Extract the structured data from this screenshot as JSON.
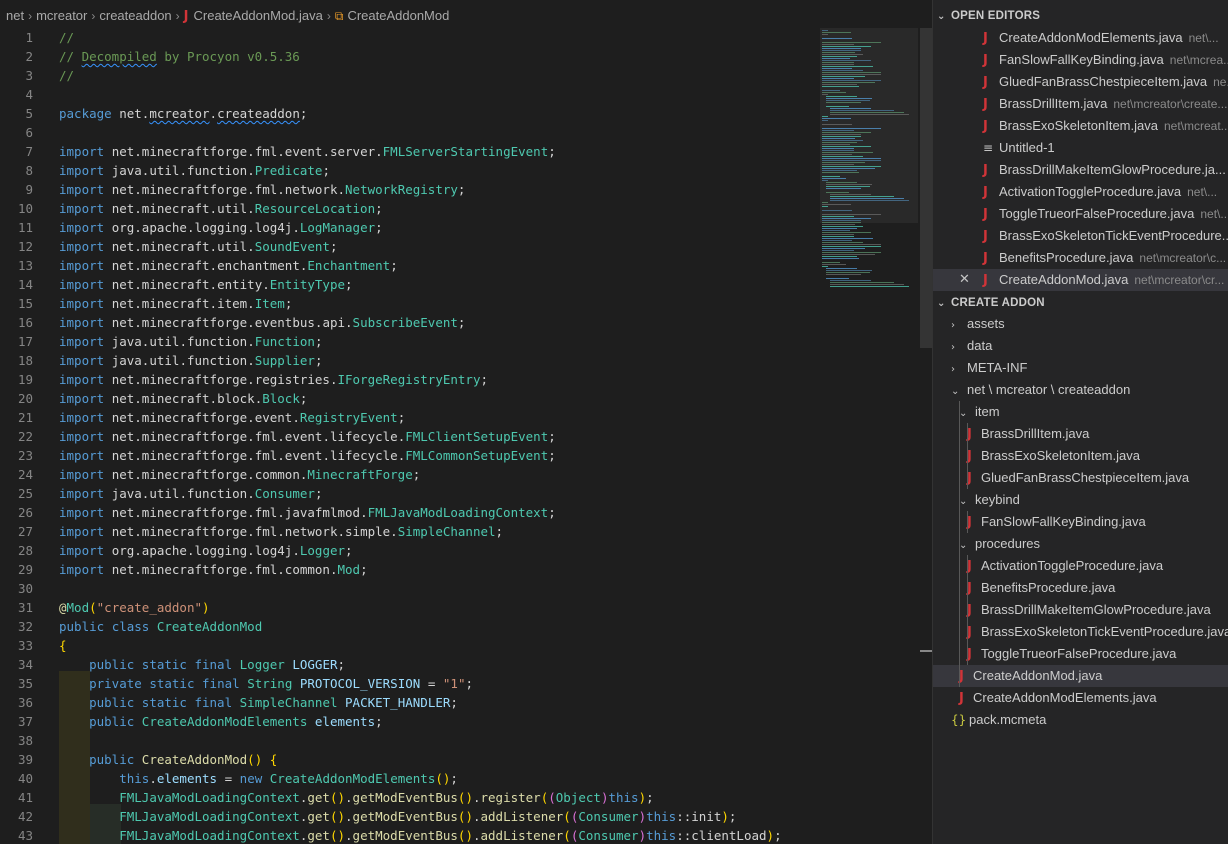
{
  "breadcrumb": {
    "items": [
      "net",
      "mcreator",
      "createaddon",
      "CreateAddonMod.java",
      "CreateAddonMod"
    ],
    "separator": "›"
  },
  "code_lines": [
    "//",
    "// Decompiled by Procyon v0.5.36",
    "//",
    "",
    "package net.mcreator.createaddon;",
    "",
    "import net.minecraftforge.fml.event.server.FMLServerStartingEvent;",
    "import java.util.function.Predicate;",
    "import net.minecraftforge.fml.network.NetworkRegistry;",
    "import net.minecraft.util.ResourceLocation;",
    "import org.apache.logging.log4j.LogManager;",
    "import net.minecraft.util.SoundEvent;",
    "import net.minecraft.enchantment.Enchantment;",
    "import net.minecraft.entity.EntityType;",
    "import net.minecraft.item.Item;",
    "import net.minecraftforge.eventbus.api.SubscribeEvent;",
    "import java.util.function.Function;",
    "import java.util.function.Supplier;",
    "import net.minecraftforge.registries.IForgeRegistryEntry;",
    "import net.minecraft.block.Block;",
    "import net.minecraftforge.event.RegistryEvent;",
    "import net.minecraftforge.fml.event.lifecycle.FMLClientSetupEvent;",
    "import net.minecraftforge.fml.event.lifecycle.FMLCommonSetupEvent;",
    "import net.minecraftforge.common.MinecraftForge;",
    "import java.util.function.Consumer;",
    "import net.minecraftforge.fml.javafmlmod.FMLJavaModLoadingContext;",
    "import net.minecraftforge.fml.network.simple.SimpleChannel;",
    "import org.apache.logging.log4j.Logger;",
    "import net.minecraftforge.fml.common.Mod;",
    "",
    "@Mod(\"create_addon\")",
    "public class CreateAddonMod",
    "{",
    "    public static final Logger LOGGER;",
    "    private static final String PROTOCOL_VERSION = \"1\";",
    "    public static final SimpleChannel PACKET_HANDLER;",
    "    public CreateAddonModElements elements;",
    "",
    "    public CreateAddonMod() {",
    "        this.elements = new CreateAddonModElements();",
    "        FMLJavaModLoadingContext.get().getModEventBus().register((Object)this);",
    "        FMLJavaModLoadingContext.get().getModEventBus().addListener((Consumer)this::init);",
    "        FMLJavaModLoadingContext.get().getModEventBus().addListener((Consumer)this::clientLoad);"
  ],
  "sidebar": {
    "open_editors_title": "OPEN EDITORS",
    "open_editors": [
      {
        "name": "CreateAddonModElements.java",
        "desc": "net\\...",
        "icon": "java"
      },
      {
        "name": "FanSlowFallKeyBinding.java",
        "desc": "net\\mcrea...",
        "icon": "java"
      },
      {
        "name": "GluedFanBrassChestpieceItem.java",
        "desc": "ne...",
        "icon": "java"
      },
      {
        "name": "BrassDrillItem.java",
        "desc": "net\\mcreator\\create...",
        "icon": "java"
      },
      {
        "name": "BrassExoSkeletonItem.java",
        "desc": "net\\mcreat...",
        "icon": "java"
      },
      {
        "name": "Untitled-1",
        "desc": "",
        "icon": "untitled"
      },
      {
        "name": "BrassDrillMakeItemGlowProcedure.ja...",
        "desc": "",
        "icon": "java"
      },
      {
        "name": "ActivationToggleProcedure.java",
        "desc": "net\\...",
        "icon": "java"
      },
      {
        "name": "ToggleTrueorFalseProcedure.java",
        "desc": "net\\...",
        "icon": "java"
      },
      {
        "name": "BrassExoSkeletonTickEventProcedure....",
        "desc": "",
        "icon": "java"
      },
      {
        "name": "BenefitsProcedure.java",
        "desc": "net\\mcreator\\c...",
        "icon": "java"
      },
      {
        "name": "CreateAddonMod.java",
        "desc": "net\\mcreator\\cr...",
        "icon": "java",
        "active": true
      }
    ],
    "project_title": "CREATE ADDON",
    "tree": [
      {
        "label": "assets",
        "type": "folder",
        "depth": 0,
        "open": false
      },
      {
        "label": "data",
        "type": "folder",
        "depth": 0,
        "open": false
      },
      {
        "label": "META-INF",
        "type": "folder",
        "depth": 0,
        "open": false
      },
      {
        "label": "net \\ mcreator \\ createaddon",
        "type": "folder",
        "depth": 0,
        "open": true
      },
      {
        "label": "item",
        "type": "folder",
        "depth": 1,
        "open": true
      },
      {
        "label": "BrassDrillItem.java",
        "type": "java",
        "depth": 2
      },
      {
        "label": "BrassExoSkeletonItem.java",
        "type": "java",
        "depth": 2
      },
      {
        "label": "GluedFanBrassChestpieceItem.java",
        "type": "java",
        "depth": 2
      },
      {
        "label": "keybind",
        "type": "folder",
        "depth": 1,
        "open": true
      },
      {
        "label": "FanSlowFallKeyBinding.java",
        "type": "java",
        "depth": 2
      },
      {
        "label": "procedures",
        "type": "folder",
        "depth": 1,
        "open": true
      },
      {
        "label": "ActivationToggleProcedure.java",
        "type": "java",
        "depth": 2
      },
      {
        "label": "BenefitsProcedure.java",
        "type": "java",
        "depth": 2
      },
      {
        "label": "BrassDrillMakeItemGlowProcedure.java",
        "type": "java",
        "depth": 2
      },
      {
        "label": "BrassExoSkeletonTickEventProcedure.java",
        "type": "java",
        "depth": 2
      },
      {
        "label": "ToggleTrueorFalseProcedure.java",
        "type": "java",
        "depth": 2
      },
      {
        "label": "CreateAddonMod.java",
        "type": "java",
        "depth": 1,
        "selected": true
      },
      {
        "label": "CreateAddonModElements.java",
        "type": "java",
        "depth": 1
      },
      {
        "label": "pack.mcmeta",
        "type": "json",
        "depth": 0
      }
    ]
  },
  "icons": {
    "java": "J",
    "untitled": "≡",
    "json": "{}",
    "close": "✕",
    "chevron_right": "›",
    "chevron_down": "⌄",
    "class": "⧉"
  },
  "colors": {
    "editor_bg": "#1e1e1e",
    "sidebar_bg": "#252526",
    "java_icon": "#d13438",
    "keyword": "#569cd6",
    "type": "#4ec9b0",
    "comment": "#6a9955",
    "string": "#ce9178"
  }
}
